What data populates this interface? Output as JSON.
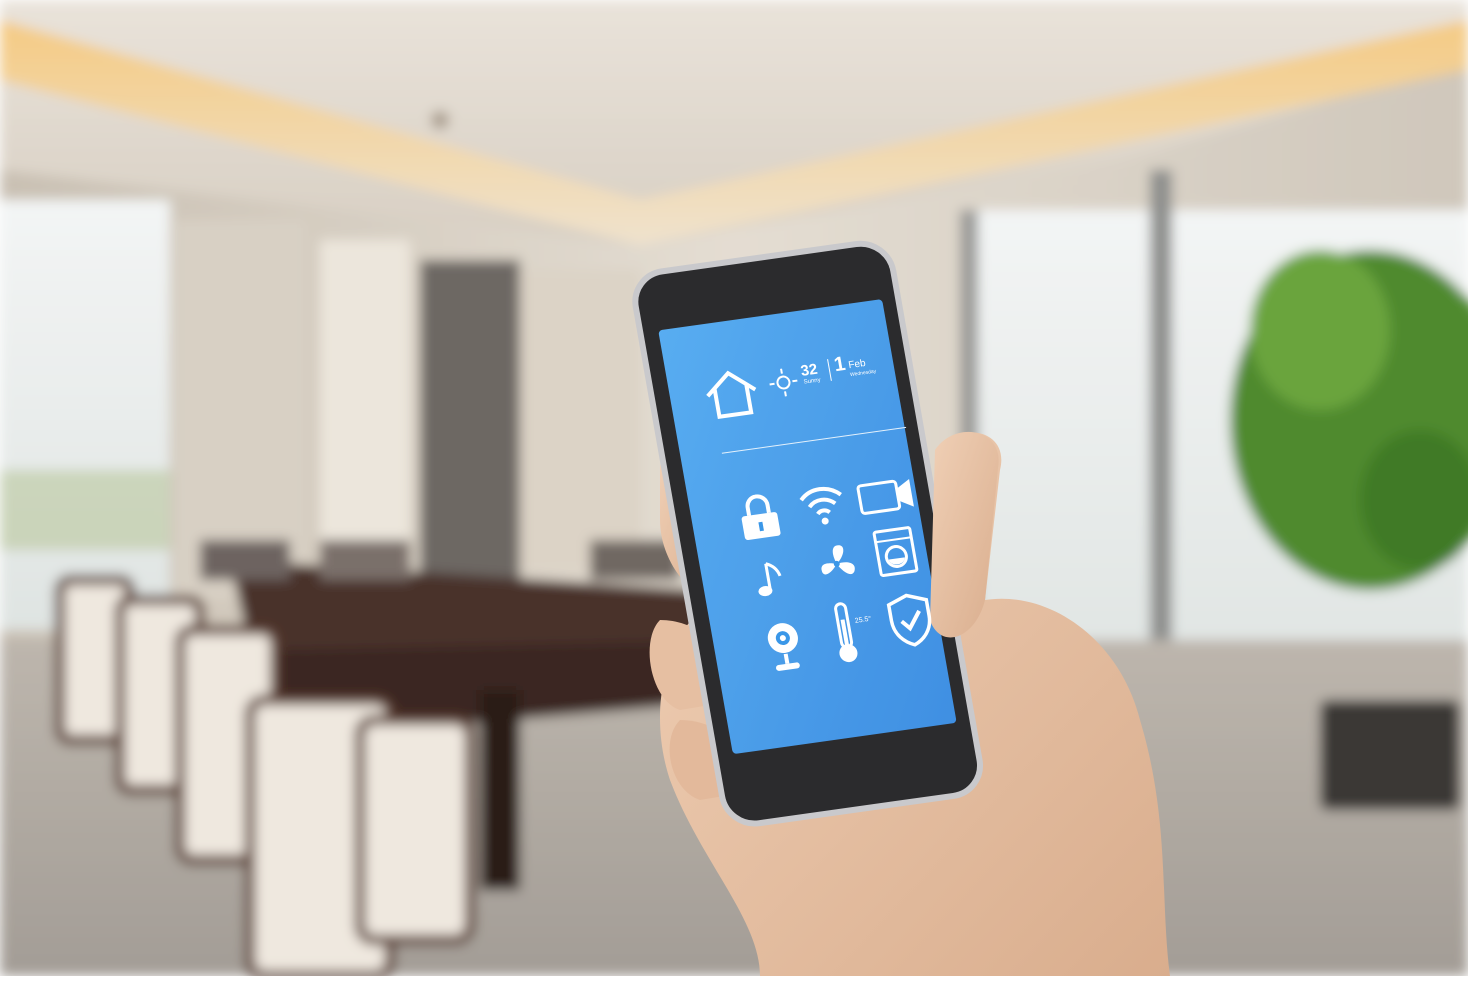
{
  "scene": {
    "kind": "photo",
    "subject": "hand holding smartphone with smart home app in a conference room"
  },
  "phone_screen": {
    "temperature": "32",
    "weather_label": "Sunny",
    "date_day": "1",
    "date_month": "Feb",
    "date_weekday": "Wednesday",
    "thermo_reading": "25.5°",
    "icons": [
      {
        "name": "home-icon"
      },
      {
        "name": "sun-icon"
      },
      {
        "name": "lock-icon"
      },
      {
        "name": "wifi-icon"
      },
      {
        "name": "video-camera-icon"
      },
      {
        "name": "music-note-icon"
      },
      {
        "name": "fan-icon"
      },
      {
        "name": "washing-machine-icon"
      },
      {
        "name": "webcam-icon"
      },
      {
        "name": "thermometer-icon"
      },
      {
        "name": "shield-check-icon"
      }
    ],
    "colors": {
      "screen_blue": "#3a97e8",
      "icon_white": "#ffffff"
    }
  }
}
